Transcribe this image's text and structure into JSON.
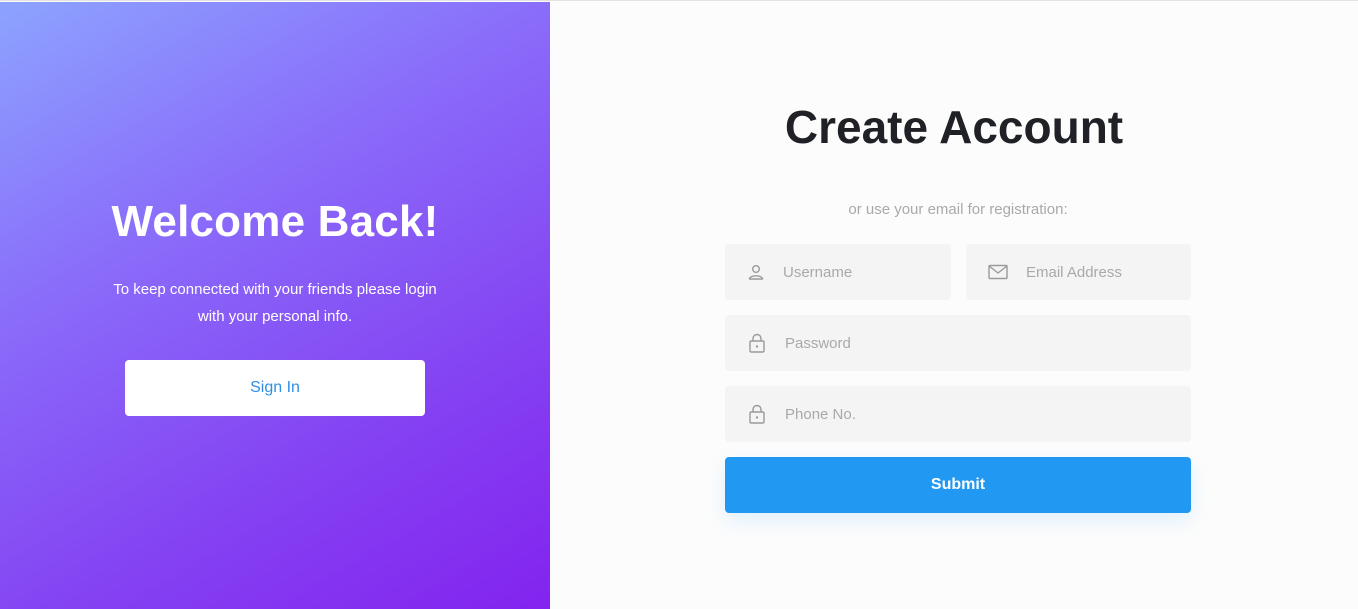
{
  "welcome": {
    "title": "Welcome Back!",
    "text": "To keep connected with your friends please login with your personal info.",
    "signin_label": "Sign In"
  },
  "form": {
    "title": "Create Account",
    "subtitle": "or use your email for registration:",
    "username": {
      "placeholder": "Username",
      "icon": "user-icon"
    },
    "email": {
      "placeholder": "Email Address",
      "icon": "mail-icon"
    },
    "password": {
      "placeholder": "Password",
      "icon": "lock-icon"
    },
    "phone": {
      "placeholder": "Phone No.",
      "icon": "lock-icon"
    },
    "submit_label": "Submit"
  },
  "colors": {
    "gradient_start": "#8ca3ff",
    "gradient_end": "#8323ef",
    "accent": "#2199f3",
    "title": "#1f2126",
    "placeholder": "#a9a9a9",
    "field_bg": "#f4f4f4"
  }
}
